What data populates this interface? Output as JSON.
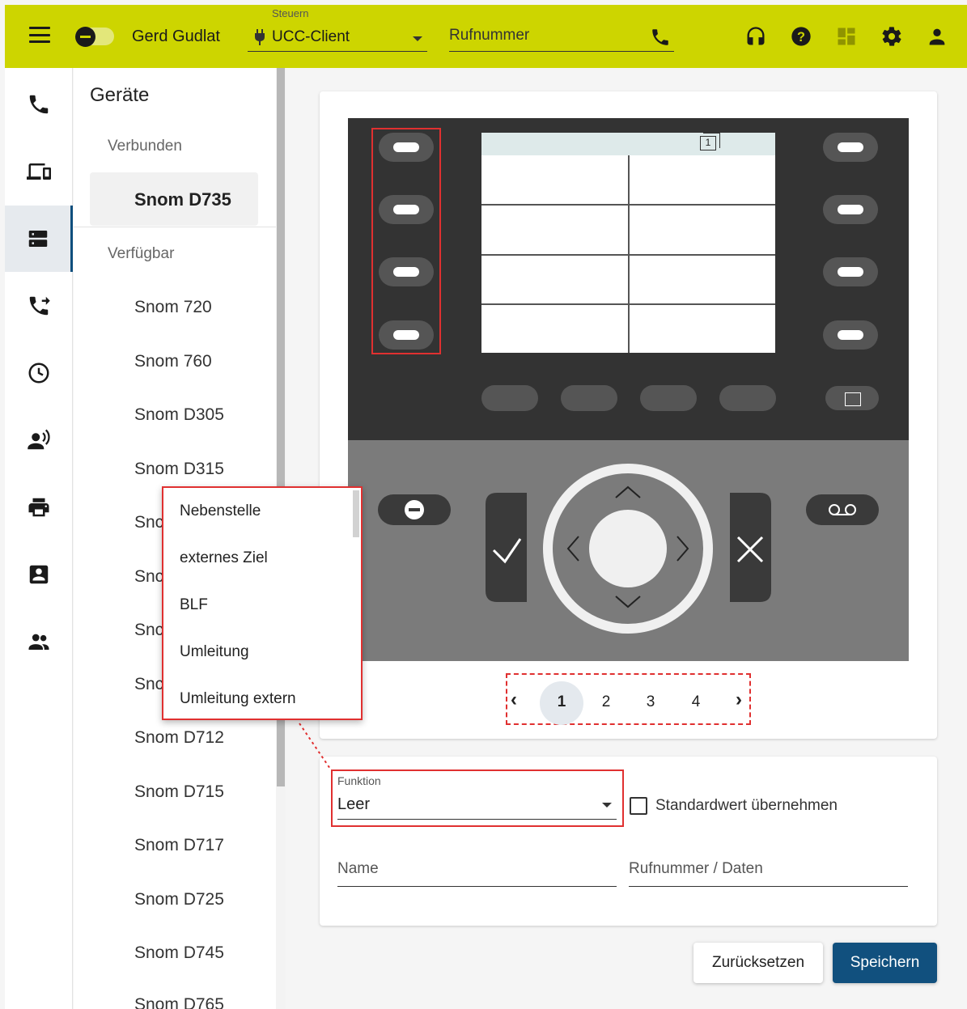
{
  "header": {
    "user_name": "Gerd Gudlat",
    "control_label": "Steuern",
    "client_value": "UCC-Client",
    "phone_placeholder": "Rufnummer",
    "accent_color": "#cdd500",
    "icons": [
      "menu-icon",
      "status-toggle",
      "plug-icon",
      "phone-icon",
      "headset-icon",
      "help-icon",
      "dashboard-icon",
      "settings-icon",
      "user-icon"
    ]
  },
  "rail": {
    "items": [
      "phone-icon",
      "devices-icon",
      "device-list-icon",
      "call-forward-icon",
      "history-icon",
      "voice-icon",
      "print-icon",
      "contact-card-icon",
      "group-icon"
    ],
    "active_index": 2
  },
  "devices": {
    "title": "Geräte",
    "connected_label": "Verbunden",
    "connected": [
      "Snom D735"
    ],
    "available_label": "Verfügbar",
    "available": [
      "Snom 720",
      "Snom 760",
      "Snom D305",
      "Snom D315",
      "Snc",
      "Snc",
      "Snc",
      "Snc",
      "Snom D712",
      "Snom D715",
      "Snom D717",
      "Snom D725",
      "Snom D745",
      "Snom D765"
    ]
  },
  "phone_screen": {
    "page_indicator": "1"
  },
  "pager": {
    "prev": "‹",
    "next": "›",
    "pages": [
      "1",
      "2",
      "3",
      "4"
    ],
    "current": "1"
  },
  "menu": {
    "items": [
      "Nebenstelle",
      "externes Ziel",
      "BLF",
      "Umleitung",
      "Umleitung extern"
    ]
  },
  "form": {
    "funktion_label": "Funktion",
    "funktion_value": "Leer",
    "default_checkbox_label": "Standardwert übernehmen",
    "name_placeholder": "Name",
    "number_placeholder": "Rufnummer / Daten"
  },
  "buttons": {
    "reset": "Zurücksetzen",
    "save": "Speichern",
    "save_color": "#11507e"
  },
  "highlight_color": "#e03030"
}
